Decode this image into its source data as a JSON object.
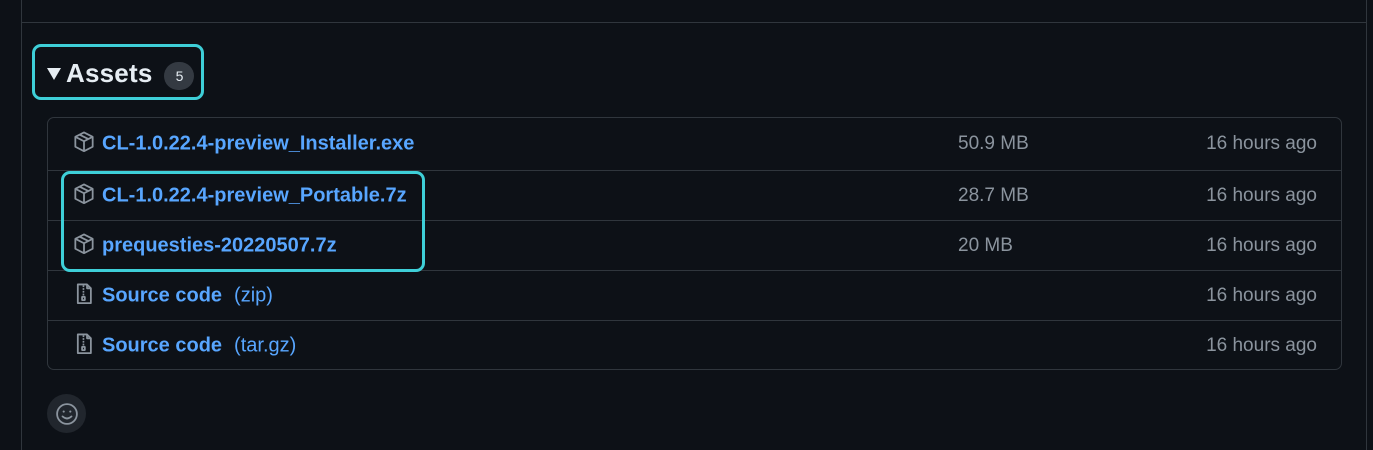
{
  "assets": {
    "title": "Assets",
    "count": "5",
    "items": [
      {
        "kind": "package",
        "name": "CL-1.0.22.4-preview_Installer.exe",
        "suffix": "",
        "size": "50.9 MB",
        "time": "16 hours ago"
      },
      {
        "kind": "package",
        "name": "CL-1.0.22.4-preview_Portable.7z",
        "suffix": "",
        "size": "28.7 MB",
        "time": "16 hours ago"
      },
      {
        "kind": "package",
        "name": "prequesties-20220507.7z",
        "suffix": "",
        "size": "20 MB",
        "time": "16 hours ago"
      },
      {
        "kind": "zip",
        "name": "Source code",
        "suffix": "(zip)",
        "size": "",
        "time": "16 hours ago"
      },
      {
        "kind": "zip",
        "name": "Source code",
        "suffix": "(tar.gz)",
        "size": "",
        "time": "16 hours ago"
      }
    ]
  },
  "icons": {
    "caret": "triangle-down-icon",
    "package": "package-icon",
    "zip": "file-zip-icon",
    "reaction": "smiley-icon"
  },
  "colors": {
    "background": "#0d1117",
    "link": "#58a6ff",
    "muted": "#8b949e",
    "border": "#30363d",
    "highlight": "#3ecfd8"
  }
}
